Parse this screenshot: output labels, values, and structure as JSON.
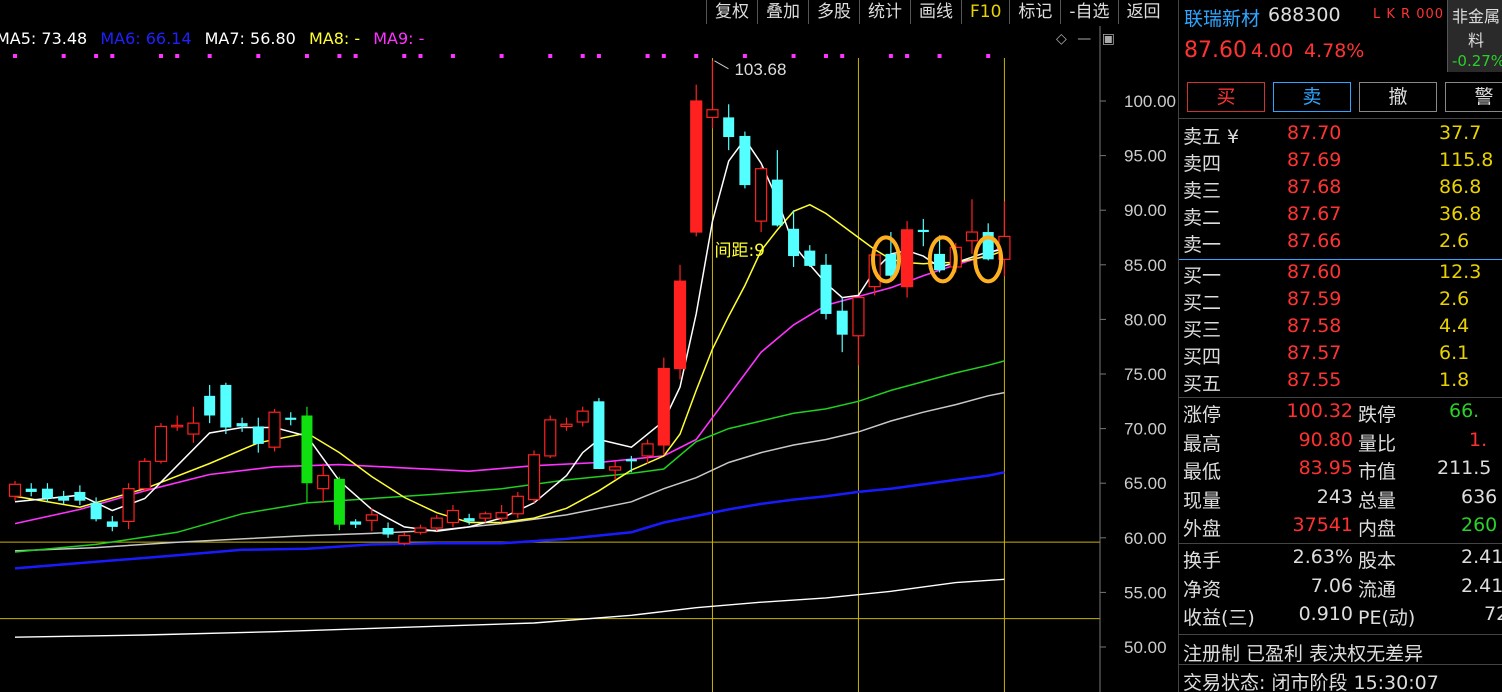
{
  "toolbar": {
    "items": [
      "复权",
      "叠加",
      "多股",
      "统计",
      "画线",
      "F10",
      "标记",
      "-自选",
      "返回"
    ]
  },
  "legend": {
    "ma5": "MA5: 73.48",
    "ma6": "MA6: 66.14",
    "ma7": "MA7: 56.80",
    "ma8": "MA8: -",
    "ma9": "MA9: -"
  },
  "colors": {
    "up": "#ff2020",
    "down": "#54ffff",
    "bigdown": "#10e010",
    "ma_white": "#ffffff",
    "ma_yellow": "#ffff30",
    "ma_magenta": "#ff33ff",
    "ma_green": "#20d020",
    "ma_grey": "#c8c8c8",
    "ma_blue": "#1a1aff",
    "highlight": "#ffb020",
    "guide": "#c8b400"
  },
  "chart_data": {
    "type": "candlestick",
    "ylim": [
      48,
      106
    ],
    "yticks": [
      "100.00",
      "95.00",
      "90.00",
      "85.00",
      "80.00",
      "75.00",
      "70.00",
      "65.00",
      "60.00",
      "55.00",
      "50.00"
    ],
    "ytick_values": [
      100,
      95,
      90,
      85,
      80,
      75,
      70,
      65,
      60,
      55,
      50
    ],
    "annotations": {
      "peak_label": "103.68",
      "peak_value": 103.68,
      "gap_label": "间距:9"
    },
    "hlines": [
      59.6,
      52.6
    ],
    "candles": [
      [
        63.8,
        65.2,
        63.4,
        64.9
      ],
      [
        64.5,
        65.0,
        63.8,
        64.2
      ],
      [
        64.5,
        65.0,
        63.3,
        63.6
      ],
      [
        63.8,
        64.3,
        63.1,
        63.4
      ],
      [
        64.2,
        64.8,
        63.0,
        63.4
      ],
      [
        63.2,
        63.7,
        61.5,
        61.7
      ],
      [
        61.5,
        62.0,
        60.6,
        61.0
      ],
      [
        61.5,
        65.0,
        60.8,
        64.5
      ],
      [
        64.5,
        67.3,
        64.2,
        67.0
      ],
      [
        67.0,
        70.5,
        66.8,
        70.2
      ],
      [
        70.2,
        71.2,
        69.8,
        70.3
      ],
      [
        69.5,
        72.0,
        68.7,
        70.5
      ],
      [
        73.0,
        74.0,
        70.5,
        71.2
      ],
      [
        74.0,
        74.2,
        69.5,
        70.1
      ],
      [
        70.5,
        71.0,
        69.7,
        70.2
      ],
      [
        70.2,
        71.0,
        67.8,
        68.6
      ],
      [
        68.3,
        71.8,
        67.9,
        71.5
      ],
      [
        71.0,
        71.5,
        70.3,
        70.8
      ],
      [
        71.2,
        72.0,
        63.2,
        65.0
      ],
      [
        64.5,
        66.8,
        63.2,
        65.7
      ],
      [
        65.4,
        65.6,
        60.7,
        61.2
      ],
      [
        61.5,
        61.7,
        60.9,
        61.2
      ],
      [
        61.6,
        62.7,
        60.6,
        62.1
      ],
      [
        60.9,
        61.4,
        60.0,
        60.3
      ],
      [
        59.5,
        60.5,
        59.3,
        60.2
      ],
      [
        60.5,
        61.2,
        60.3,
        60.9
      ],
      [
        60.9,
        62.1,
        60.6,
        61.8
      ],
      [
        61.4,
        63.0,
        61.0,
        62.5
      ],
      [
        61.8,
        62.2,
        61.2,
        61.5
      ],
      [
        61.8,
        62.4,
        61.4,
        62.2
      ],
      [
        61.8,
        63.0,
        61.4,
        62.3
      ],
      [
        62.2,
        64.2,
        61.8,
        63.8
      ],
      [
        63.5,
        68.0,
        63.2,
        67.6
      ],
      [
        67.5,
        71.2,
        67.3,
        70.8
      ],
      [
        70.2,
        71.0,
        69.8,
        70.4
      ],
      [
        70.6,
        72.0,
        70.2,
        71.6
      ],
      [
        72.5,
        72.8,
        67.8,
        66.3
      ],
      [
        66.2,
        67.0,
        65.3,
        66.5
      ],
      [
        67.2,
        67.5,
        66.0,
        67.0
      ],
      [
        67.5,
        69.0,
        66.8,
        68.6
      ],
      [
        68.5,
        76.5,
        67.6,
        75.5
      ],
      [
        75.5,
        85.0,
        74.5,
        83.5
      ],
      [
        88.0,
        101.5,
        87.6,
        100.0
      ],
      [
        98.5,
        103.68,
        97.5,
        99.2
      ],
      [
        98.5,
        99.7,
        95.5,
        96.7
      ],
      [
        96.8,
        97.2,
        92.0,
        92.3
      ],
      [
        89.0,
        94.0,
        88.0,
        93.8
      ],
      [
        92.8,
        95.5,
        88.5,
        88.6
      ],
      [
        88.3,
        90.0,
        84.8,
        85.8
      ],
      [
        86.3,
        86.8,
        84.8,
        84.9
      ],
      [
        85.0,
        86.0,
        80.0,
        80.5
      ],
      [
        80.8,
        82.0,
        77.0,
        78.6
      ],
      [
        78.5,
        82.0,
        75.8,
        82.0
      ],
      [
        83.0,
        86.5,
        82.2,
        85.9
      ],
      [
        86.0,
        88.0,
        83.5,
        84.0
      ],
      [
        83.0,
        89.0,
        82.0,
        88.2
      ],
      [
        88.2,
        89.2,
        86.7,
        88.0
      ],
      [
        86.0,
        87.7,
        84.3,
        84.5
      ],
      [
        84.8,
        87.0,
        84.3,
        86.6
      ],
      [
        87.2,
        91.0,
        86.0,
        88.0
      ],
      [
        88.0,
        88.8,
        85.4,
        85.5
      ],
      [
        85.5,
        90.8,
        83.95,
        87.6
      ]
    ],
    "ma_white": [
      [
        0,
        63.3
      ],
      [
        4,
        63.9
      ],
      [
        6,
        62.5
      ],
      [
        8,
        63.6
      ],
      [
        10,
        66.6
      ],
      [
        12,
        69.6
      ],
      [
        14,
        70.1
      ],
      [
        16,
        70.1
      ],
      [
        18,
        69.3
      ],
      [
        20,
        65.2
      ],
      [
        22,
        62.6
      ],
      [
        24,
        61.0
      ],
      [
        26,
        60.6
      ],
      [
        28,
        61.0
      ],
      [
        30,
        61.8
      ],
      [
        32,
        63.2
      ],
      [
        34,
        65.7
      ],
      [
        35,
        67.8
      ],
      [
        36,
        69.0
      ],
      [
        38,
        68.3
      ],
      [
        40,
        70.7
      ],
      [
        41,
        73.8
      ],
      [
        42,
        80.5
      ],
      [
        43,
        89.0
      ],
      [
        44,
        94.5
      ],
      [
        45,
        96.5
      ],
      [
        46,
        94.3
      ],
      [
        47,
        91.0
      ],
      [
        48,
        86.8
      ],
      [
        49,
        85.0
      ],
      [
        50,
        83.3
      ],
      [
        51,
        82.0
      ],
      [
        52,
        82.2
      ],
      [
        53,
        84.5
      ],
      [
        54,
        86.0
      ],
      [
        55,
        86.3
      ],
      [
        56,
        85.8
      ],
      [
        57,
        84.8
      ],
      [
        58,
        85.2
      ],
      [
        59,
        85.7
      ],
      [
        60,
        86.2
      ],
      [
        61,
        86.4
      ]
    ],
    "ma_yellow": [
      [
        0,
        63.8
      ],
      [
        4,
        62.8
      ],
      [
        8,
        64.5
      ],
      [
        12,
        66.8
      ],
      [
        15,
        68.7
      ],
      [
        18,
        69.6
      ],
      [
        20,
        67.8
      ],
      [
        22,
        65.6
      ],
      [
        24,
        63.7
      ],
      [
        26,
        62.3
      ],
      [
        28,
        61.4
      ],
      [
        30,
        61.4
      ],
      [
        32,
        61.8
      ],
      [
        34,
        62.7
      ],
      [
        36,
        64.3
      ],
      [
        38,
        66.2
      ],
      [
        40,
        67.5
      ],
      [
        41,
        69.5
      ],
      [
        42,
        73.5
      ],
      [
        43,
        77.3
      ],
      [
        44,
        80.3
      ],
      [
        45,
        83.1
      ],
      [
        46,
        86.3
      ],
      [
        47,
        88.2
      ],
      [
        48,
        89.9
      ],
      [
        49,
        90.5
      ],
      [
        50,
        89.7
      ],
      [
        52,
        87.5
      ],
      [
        53,
        86.4
      ],
      [
        54,
        85.5
      ],
      [
        55,
        85.2
      ],
      [
        56,
        85.1
      ],
      [
        57,
        85.2
      ],
      [
        58,
        85.2
      ],
      [
        59,
        85.5
      ],
      [
        60,
        85.8
      ],
      [
        61,
        86.3
      ]
    ],
    "ma_magenta": [
      [
        0,
        61.3
      ],
      [
        4,
        62.6
      ],
      [
        8,
        64.3
      ],
      [
        12,
        65.8
      ],
      [
        16,
        66.5
      ],
      [
        20,
        66.7
      ],
      [
        24,
        66.4
      ],
      [
        28,
        66.1
      ],
      [
        32,
        66.6
      ],
      [
        36,
        66.9
      ],
      [
        40,
        67.5
      ],
      [
        42,
        69.0
      ],
      [
        44,
        73.0
      ],
      [
        46,
        77.0
      ],
      [
        48,
        79.5
      ],
      [
        50,
        81.3
      ],
      [
        52,
        82.1
      ],
      [
        54,
        82.9
      ],
      [
        56,
        84.0
      ],
      [
        58,
        85.0
      ],
      [
        60,
        85.9
      ],
      [
        61,
        86.8
      ]
    ],
    "ma_green": [
      [
        0,
        58.7
      ],
      [
        5,
        59.4
      ],
      [
        10,
        60.5
      ],
      [
        14,
        62.2
      ],
      [
        18,
        63.2
      ],
      [
        22,
        63.6
      ],
      [
        26,
        64.0
      ],
      [
        30,
        64.5
      ],
      [
        34,
        65.3
      ],
      [
        38,
        65.9
      ],
      [
        40,
        66.3
      ],
      [
        42,
        68.8
      ],
      [
        44,
        70.0
      ],
      [
        46,
        70.7
      ],
      [
        48,
        71.4
      ],
      [
        50,
        71.8
      ],
      [
        52,
        72.5
      ],
      [
        54,
        73.5
      ],
      [
        56,
        74.3
      ],
      [
        58,
        75.1
      ],
      [
        60,
        75.8
      ],
      [
        61,
        76.2
      ]
    ],
    "ma_grey": [
      [
        0,
        58.8
      ],
      [
        5,
        59.1
      ],
      [
        10,
        59.6
      ],
      [
        14,
        59.9
      ],
      [
        18,
        60.2
      ],
      [
        22,
        60.4
      ],
      [
        26,
        60.7
      ],
      [
        30,
        61.3
      ],
      [
        34,
        62.1
      ],
      [
        38,
        63.3
      ],
      [
        40,
        64.5
      ],
      [
        42,
        65.5
      ],
      [
        44,
        66.9
      ],
      [
        46,
        67.8
      ],
      [
        48,
        68.5
      ],
      [
        50,
        69.0
      ],
      [
        52,
        69.7
      ],
      [
        54,
        70.7
      ],
      [
        56,
        71.5
      ],
      [
        58,
        72.2
      ],
      [
        60,
        73.0
      ],
      [
        61,
        73.3
      ]
    ],
    "ma_blue": [
      [
        0,
        57.2
      ],
      [
        5,
        57.8
      ],
      [
        10,
        58.4
      ],
      [
        14,
        58.9
      ],
      [
        18,
        59.0
      ],
      [
        22,
        59.4
      ],
      [
        26,
        59.5
      ],
      [
        30,
        59.5
      ],
      [
        34,
        59.9
      ],
      [
        38,
        60.5
      ],
      [
        40,
        61.4
      ],
      [
        42,
        62.0
      ],
      [
        44,
        62.6
      ],
      [
        46,
        63.1
      ],
      [
        48,
        63.5
      ],
      [
        50,
        63.8
      ],
      [
        52,
        64.2
      ],
      [
        54,
        64.5
      ],
      [
        56,
        64.9
      ],
      [
        58,
        65.3
      ],
      [
        60,
        65.7
      ],
      [
        61,
        66.0
      ]
    ],
    "ma_white_low": [
      [
        0,
        50.9
      ],
      [
        8,
        51.1
      ],
      [
        16,
        51.4
      ],
      [
        24,
        51.8
      ],
      [
        32,
        52.2
      ],
      [
        38,
        52.9
      ],
      [
        42,
        53.6
      ],
      [
        46,
        54.1
      ],
      [
        50,
        54.5
      ],
      [
        54,
        55.1
      ],
      [
        58,
        55.9
      ],
      [
        61,
        56.2
      ]
    ],
    "vlines": [
      43,
      52,
      61
    ],
    "ellipses": [
      53.7,
      57.2,
      60.0
    ]
  },
  "quote": {
    "name": "联瑞新材",
    "code": "688300",
    "flags": "L K R 000",
    "price": "87.60",
    "change": "4.00",
    "pct": "4.78%",
    "sector_line1": "非金属",
    "sector_line2": "料",
    "sector_pct": "-0.27%"
  },
  "buttons": {
    "buy": "买",
    "sell": "卖",
    "cancel": "撤",
    "alert": "警"
  },
  "asks": [
    {
      "label": "卖五 ¥",
      "price": "87.70",
      "vol": "37.7"
    },
    {
      "label": "卖四",
      "price": "87.69",
      "vol": "115.8"
    },
    {
      "label": "卖三",
      "price": "87.68",
      "vol": "86.8"
    },
    {
      "label": "卖二",
      "price": "87.67",
      "vol": "36.8"
    },
    {
      "label": "卖一",
      "price": "87.66",
      "vol": "2.6"
    }
  ],
  "bids": [
    {
      "label": "买一",
      "price": "87.60",
      "vol": "12.3"
    },
    {
      "label": "买二",
      "price": "87.59",
      "vol": "2.6"
    },
    {
      "label": "买三",
      "price": "87.58",
      "vol": "4.4"
    },
    {
      "label": "买四",
      "price": "87.57",
      "vol": "6.1"
    },
    {
      "label": "买五",
      "price": "87.55",
      "vol": "1.8"
    }
  ],
  "stats": [
    {
      "l1": "涨停",
      "v1": "100.32",
      "c1": "#ff3030",
      "l2": "跌停",
      "v2": "66.",
      "c2": "#2ad02a"
    },
    {
      "l1": "最高",
      "v1": "90.80",
      "c1": "#ff3030",
      "l2": "量比",
      "v2": "1.",
      "c2": "#ff3030"
    },
    {
      "l1": "最低",
      "v1": "83.95",
      "c1": "#ff3030",
      "l2": "市值",
      "v2": "211.5",
      "c2": "#dddddd"
    },
    {
      "l1": "现量",
      "v1": "243",
      "c1": "#dddddd",
      "l2": "总量",
      "v2": "636",
      "c2": "#dddddd"
    },
    {
      "l1": "外盘",
      "v1": "37541",
      "c1": "#ff3030",
      "l2": "内盘",
      "v2": "260",
      "c2": "#2ad02a"
    },
    {
      "l1": "换手",
      "v1": "2.63%",
      "c1": "#dddddd",
      "l2": "股本",
      "v2": "2.41",
      "c2": "#dddddd"
    },
    {
      "l1": "净资",
      "v1": "7.06",
      "c1": "#dddddd",
      "l2": "流通",
      "v2": "2.41",
      "c2": "#dddddd"
    },
    {
      "l1": "收益(三)",
      "v1": "0.910",
      "c1": "#dddddd",
      "l2": "PE(动)",
      "v2": "72",
      "c2": "#dddddd"
    }
  ],
  "footer": {
    "tags": "注册制 已盈利 表决权无差异",
    "status": "交易状态: 闭市阶段 15:30:07"
  }
}
